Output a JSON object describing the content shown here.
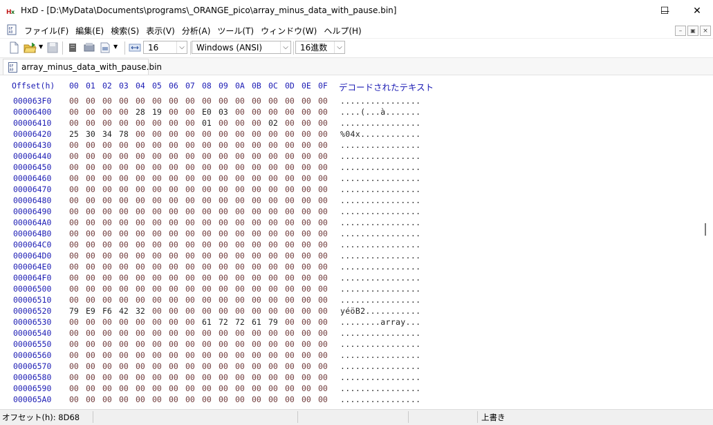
{
  "window": {
    "app_icon": "hxd-icon",
    "title": "HxD - [D:\\MyData\\Documents\\programs\\_ORANGE_pico\\array_minus_data_with_pause.bin]",
    "minimize_glyph": "—",
    "maximize_glyph": "☐",
    "close_glyph": "✕"
  },
  "menu": {
    "items": [
      "ファイル(F)",
      "編集(E)",
      "検索(S)",
      "表示(V)",
      "分析(A)",
      "ツール(T)",
      "ウィンドウ(W)",
      "ヘルプ(H)"
    ],
    "mdi_minimize": "–",
    "mdi_restore": "🗗",
    "mdi_close": "×"
  },
  "toolbar": {
    "bytes_per_row": "16",
    "charset": "Windows (ANSI)",
    "offset_base": "16進数"
  },
  "tab": {
    "label": "array_minus_data_with_pause.bin"
  },
  "hex": {
    "offset_header": "Offset(h)",
    "columns": [
      "00",
      "01",
      "02",
      "03",
      "04",
      "05",
      "06",
      "07",
      "08",
      "09",
      "0A",
      "0B",
      "0C",
      "0D",
      "0E",
      "0F"
    ],
    "decoded_header": "デコードされたテキスト",
    "rows": [
      {
        "offset": "000063F0",
        "bytes": [
          "00",
          "00",
          "00",
          "00",
          "00",
          "00",
          "00",
          "00",
          "00",
          "00",
          "00",
          "00",
          "00",
          "00",
          "00",
          "00"
        ],
        "text": "................"
      },
      {
        "offset": "00006400",
        "bytes": [
          "00",
          "00",
          "00",
          "00",
          "28",
          "19",
          "00",
          "00",
          "E0",
          "03",
          "00",
          "00",
          "00",
          "00",
          "00",
          "00"
        ],
        "text": "....(...à......."
      },
      {
        "offset": "00006410",
        "bytes": [
          "00",
          "00",
          "00",
          "00",
          "00",
          "00",
          "00",
          "00",
          "01",
          "00",
          "00",
          "00",
          "02",
          "00",
          "00",
          "00"
        ],
        "text": "................"
      },
      {
        "offset": "00006420",
        "bytes": [
          "25",
          "30",
          "34",
          "78",
          "00",
          "00",
          "00",
          "00",
          "00",
          "00",
          "00",
          "00",
          "00",
          "00",
          "00",
          "00"
        ],
        "text": "%04x............"
      },
      {
        "offset": "00006430",
        "bytes": [
          "00",
          "00",
          "00",
          "00",
          "00",
          "00",
          "00",
          "00",
          "00",
          "00",
          "00",
          "00",
          "00",
          "00",
          "00",
          "00"
        ],
        "text": "................"
      },
      {
        "offset": "00006440",
        "bytes": [
          "00",
          "00",
          "00",
          "00",
          "00",
          "00",
          "00",
          "00",
          "00",
          "00",
          "00",
          "00",
          "00",
          "00",
          "00",
          "00"
        ],
        "text": "................"
      },
      {
        "offset": "00006450",
        "bytes": [
          "00",
          "00",
          "00",
          "00",
          "00",
          "00",
          "00",
          "00",
          "00",
          "00",
          "00",
          "00",
          "00",
          "00",
          "00",
          "00"
        ],
        "text": "................"
      },
      {
        "offset": "00006460",
        "bytes": [
          "00",
          "00",
          "00",
          "00",
          "00",
          "00",
          "00",
          "00",
          "00",
          "00",
          "00",
          "00",
          "00",
          "00",
          "00",
          "00"
        ],
        "text": "................"
      },
      {
        "offset": "00006470",
        "bytes": [
          "00",
          "00",
          "00",
          "00",
          "00",
          "00",
          "00",
          "00",
          "00",
          "00",
          "00",
          "00",
          "00",
          "00",
          "00",
          "00"
        ],
        "text": "................"
      },
      {
        "offset": "00006480",
        "bytes": [
          "00",
          "00",
          "00",
          "00",
          "00",
          "00",
          "00",
          "00",
          "00",
          "00",
          "00",
          "00",
          "00",
          "00",
          "00",
          "00"
        ],
        "text": "................"
      },
      {
        "offset": "00006490",
        "bytes": [
          "00",
          "00",
          "00",
          "00",
          "00",
          "00",
          "00",
          "00",
          "00",
          "00",
          "00",
          "00",
          "00",
          "00",
          "00",
          "00"
        ],
        "text": "................"
      },
      {
        "offset": "000064A0",
        "bytes": [
          "00",
          "00",
          "00",
          "00",
          "00",
          "00",
          "00",
          "00",
          "00",
          "00",
          "00",
          "00",
          "00",
          "00",
          "00",
          "00"
        ],
        "text": "................"
      },
      {
        "offset": "000064B0",
        "bytes": [
          "00",
          "00",
          "00",
          "00",
          "00",
          "00",
          "00",
          "00",
          "00",
          "00",
          "00",
          "00",
          "00",
          "00",
          "00",
          "00"
        ],
        "text": "................"
      },
      {
        "offset": "000064C0",
        "bytes": [
          "00",
          "00",
          "00",
          "00",
          "00",
          "00",
          "00",
          "00",
          "00",
          "00",
          "00",
          "00",
          "00",
          "00",
          "00",
          "00"
        ],
        "text": "................"
      },
      {
        "offset": "000064D0",
        "bytes": [
          "00",
          "00",
          "00",
          "00",
          "00",
          "00",
          "00",
          "00",
          "00",
          "00",
          "00",
          "00",
          "00",
          "00",
          "00",
          "00"
        ],
        "text": "................"
      },
      {
        "offset": "000064E0",
        "bytes": [
          "00",
          "00",
          "00",
          "00",
          "00",
          "00",
          "00",
          "00",
          "00",
          "00",
          "00",
          "00",
          "00",
          "00",
          "00",
          "00"
        ],
        "text": "................"
      },
      {
        "offset": "000064F0",
        "bytes": [
          "00",
          "00",
          "00",
          "00",
          "00",
          "00",
          "00",
          "00",
          "00",
          "00",
          "00",
          "00",
          "00",
          "00",
          "00",
          "00"
        ],
        "text": "................"
      },
      {
        "offset": "00006500",
        "bytes": [
          "00",
          "00",
          "00",
          "00",
          "00",
          "00",
          "00",
          "00",
          "00",
          "00",
          "00",
          "00",
          "00",
          "00",
          "00",
          "00"
        ],
        "text": "................"
      },
      {
        "offset": "00006510",
        "bytes": [
          "00",
          "00",
          "00",
          "00",
          "00",
          "00",
          "00",
          "00",
          "00",
          "00",
          "00",
          "00",
          "00",
          "00",
          "00",
          "00"
        ],
        "text": "................"
      },
      {
        "offset": "00006520",
        "bytes": [
          "79",
          "E9",
          "F6",
          "42",
          "32",
          "00",
          "00",
          "00",
          "00",
          "00",
          "00",
          "00",
          "00",
          "00",
          "00",
          "00"
        ],
        "text": "yéöB2..........."
      },
      {
        "offset": "00006530",
        "bytes": [
          "00",
          "00",
          "00",
          "00",
          "00",
          "00",
          "00",
          "00",
          "61",
          "72",
          "72",
          "61",
          "79",
          "00",
          "00",
          "00"
        ],
        "text": "........array..."
      },
      {
        "offset": "00006540",
        "bytes": [
          "00",
          "00",
          "00",
          "00",
          "00",
          "00",
          "00",
          "00",
          "00",
          "00",
          "00",
          "00",
          "00",
          "00",
          "00",
          "00"
        ],
        "text": "................"
      },
      {
        "offset": "00006550",
        "bytes": [
          "00",
          "00",
          "00",
          "00",
          "00",
          "00",
          "00",
          "00",
          "00",
          "00",
          "00",
          "00",
          "00",
          "00",
          "00",
          "00"
        ],
        "text": "................"
      },
      {
        "offset": "00006560",
        "bytes": [
          "00",
          "00",
          "00",
          "00",
          "00",
          "00",
          "00",
          "00",
          "00",
          "00",
          "00",
          "00",
          "00",
          "00",
          "00",
          "00"
        ],
        "text": "................"
      },
      {
        "offset": "00006570",
        "bytes": [
          "00",
          "00",
          "00",
          "00",
          "00",
          "00",
          "00",
          "00",
          "00",
          "00",
          "00",
          "00",
          "00",
          "00",
          "00",
          "00"
        ],
        "text": "................"
      },
      {
        "offset": "00006580",
        "bytes": [
          "00",
          "00",
          "00",
          "00",
          "00",
          "00",
          "00",
          "00",
          "00",
          "00",
          "00",
          "00",
          "00",
          "00",
          "00",
          "00"
        ],
        "text": "................"
      },
      {
        "offset": "00006590",
        "bytes": [
          "00",
          "00",
          "00",
          "00",
          "00",
          "00",
          "00",
          "00",
          "00",
          "00",
          "00",
          "00",
          "00",
          "00",
          "00",
          "00"
        ],
        "text": "................"
      },
      {
        "offset": "000065A0",
        "bytes": [
          "00",
          "00",
          "00",
          "00",
          "00",
          "00",
          "00",
          "00",
          "00",
          "00",
          "00",
          "00",
          "00",
          "00",
          "00",
          "00"
        ],
        "text": "................"
      }
    ]
  },
  "status": {
    "offset": "オフセット(h): 8D68",
    "mode": "上書き"
  },
  "colors": {
    "offset_text": "#1c1cb4",
    "zero_byte": "#6f3a3a",
    "nonzero_byte": "#222222"
  }
}
